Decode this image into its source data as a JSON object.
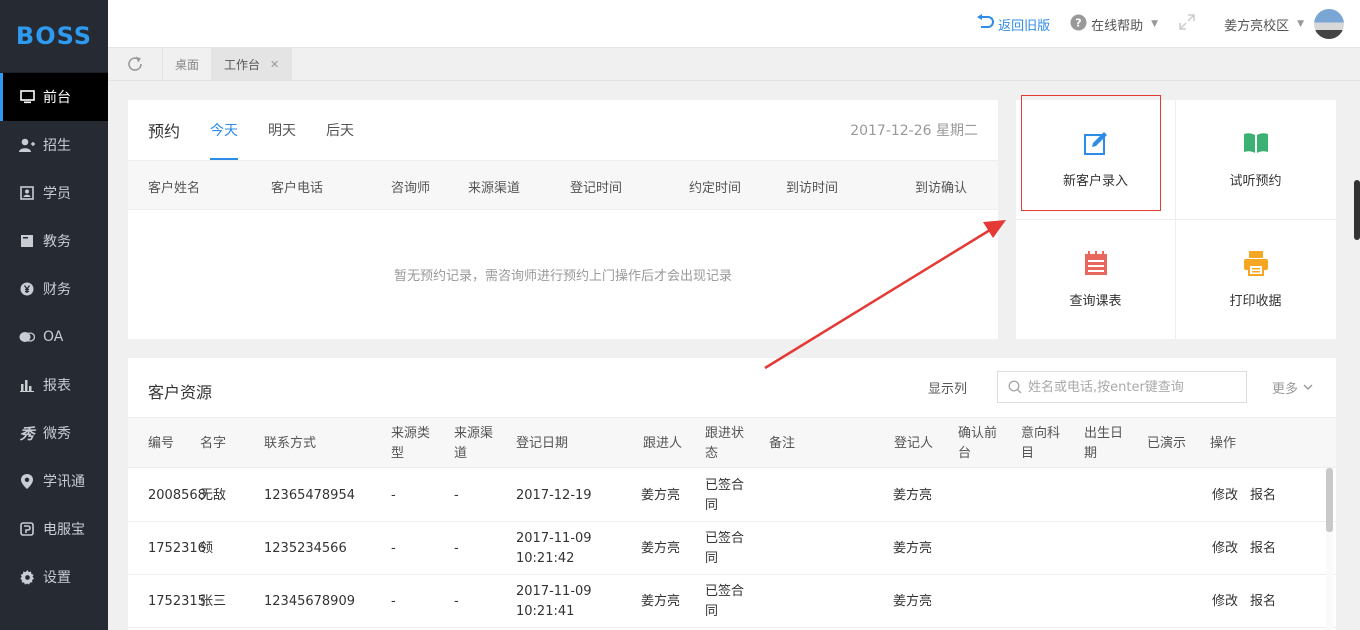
{
  "app": {
    "logo": "BOSS"
  },
  "sidebar": {
    "items": [
      {
        "label": "前台",
        "icon": "monitor-icon"
      },
      {
        "label": "招生",
        "icon": "user-add-icon"
      },
      {
        "label": "学员",
        "icon": "id-card-icon"
      },
      {
        "label": "教务",
        "icon": "book-icon"
      },
      {
        "label": "财务",
        "icon": "yen-icon"
      },
      {
        "label": "OA",
        "icon": "chat-icon"
      },
      {
        "label": "报表",
        "icon": "bar-chart-icon"
      },
      {
        "label": "微秀",
        "icon": "xiu-icon"
      },
      {
        "label": "学讯通",
        "icon": "location-icon"
      },
      {
        "label": "电服宝",
        "icon": "phone-icon"
      },
      {
        "label": "设置",
        "icon": "gear-icon"
      }
    ]
  },
  "topbar": {
    "back_label": "返回旧版",
    "help_label": "在线帮助",
    "campus_label": "姜方亮校区"
  },
  "tabs": [
    {
      "label": "桌面"
    },
    {
      "label": "工作台"
    }
  ],
  "appointment": {
    "title": "预约",
    "tabs": [
      "今天",
      "明天",
      "后天"
    ],
    "date": "2017-12-26 星期二",
    "columns": [
      "客户姓名",
      "客户电话",
      "咨询师",
      "来源渠道",
      "登记时间",
      "约定时间",
      "到访时间",
      "到访确认"
    ],
    "empty_text": "暂无预约记录，需咨询师进行预约上门操作后才会出现记录"
  },
  "quick_actions": [
    {
      "label": "新客户录入",
      "icon": "edit-icon",
      "color": "#2e8be6"
    },
    {
      "label": "试听预约",
      "icon": "open-book-icon",
      "color": "#3bb273"
    },
    {
      "label": "查询课表",
      "icon": "calendar-icon",
      "color": "#e8685e"
    },
    {
      "label": "打印收据",
      "icon": "printer-icon",
      "color": "#f5a623"
    }
  ],
  "customers": {
    "title": "客户资源",
    "show_columns_label": "显示列",
    "search_placeholder": "姓名或电话,按enter键查询",
    "more_label": "更多",
    "columns": [
      "编号",
      "名字",
      "联系方式",
      "来源类型",
      "来源渠道",
      "登记日期",
      "跟进人",
      "跟进状态",
      "备注",
      "登记人",
      "确认前台",
      "意向科目",
      "出生日期",
      "已演示",
      "操作"
    ],
    "rows": [
      {
        "id": "2008568",
        "name": "无敌",
        "phone": "12365478954",
        "source_type": "-",
        "source_channel": "-",
        "date": "2017-12-19",
        "follower": "姜方亮",
        "status": "已签合同",
        "registrar": "姜方亮",
        "edit": "修改",
        "enroll": "报名"
      },
      {
        "id": "1752316",
        "name": "领",
        "phone": "1235234566",
        "source_type": "-",
        "source_channel": "-",
        "date": "2017-11-09 10:21:42",
        "follower": "姜方亮",
        "status": "已签合同",
        "registrar": "姜方亮",
        "edit": "修改",
        "enroll": "报名"
      },
      {
        "id": "1752315",
        "name": "张三",
        "phone": "12345678909",
        "source_type": "-",
        "source_channel": "-",
        "date": "2017-11-09 10:21:41",
        "follower": "姜方亮",
        "status": "已签合同",
        "registrar": "姜方亮",
        "edit": "修改",
        "enroll": "报名"
      }
    ]
  },
  "colors": {
    "accent": "#2e8be6",
    "sidebar_bg": "#252a33",
    "annotation_red": "#e53935"
  }
}
